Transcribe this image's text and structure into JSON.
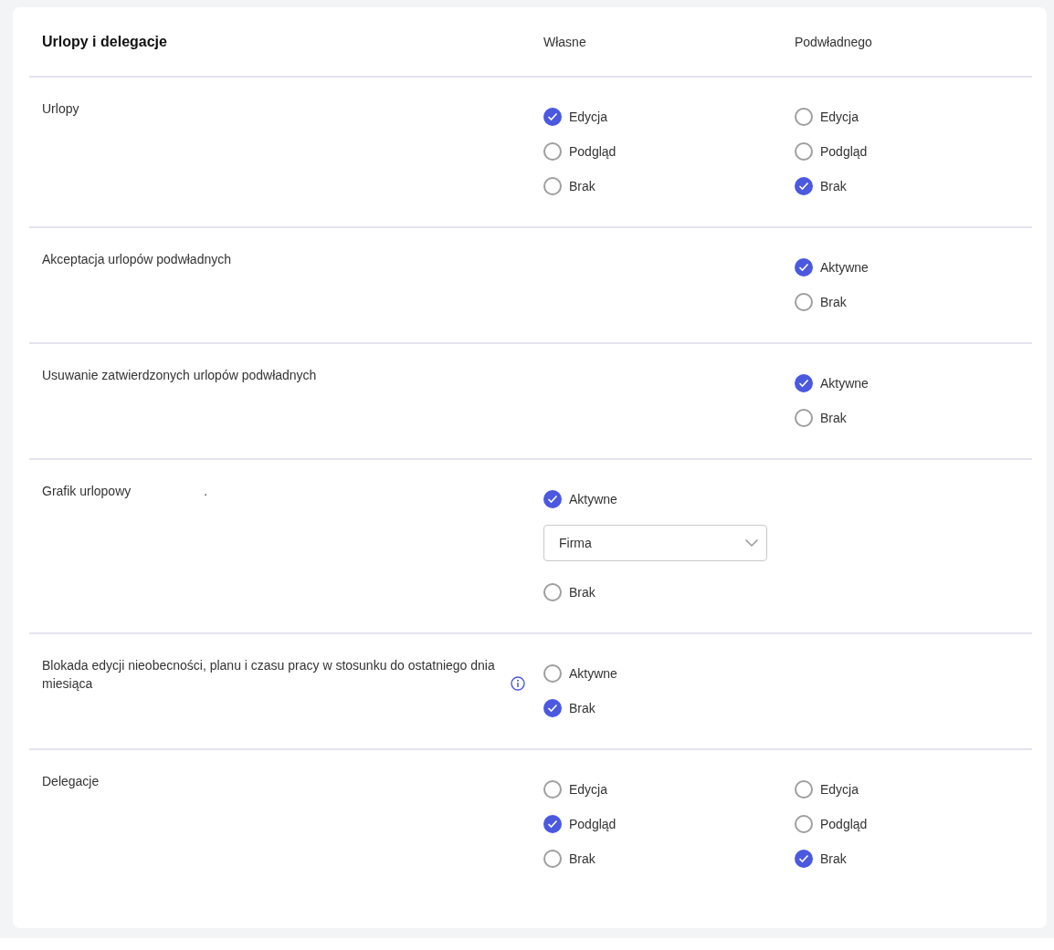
{
  "header": {
    "title": "Urlopy i delegacje",
    "columns": [
      "Własne",
      "Podwładnego"
    ]
  },
  "rows": [
    {
      "label": "Urlopy",
      "info": false,
      "own": [
        {
          "kind": "radio",
          "label": "Edycja",
          "selected": true
        },
        {
          "kind": "radio",
          "label": "Podgląd",
          "selected": false
        },
        {
          "kind": "radio",
          "label": "Brak",
          "selected": false
        }
      ],
      "sub": [
        {
          "kind": "radio",
          "label": "Edycja",
          "selected": false
        },
        {
          "kind": "radio",
          "label": "Podgląd",
          "selected": false
        },
        {
          "kind": "radio",
          "label": "Brak",
          "selected": true
        }
      ]
    },
    {
      "label": "Akceptacja urlopów podwładnych",
      "info": false,
      "own": [],
      "sub": [
        {
          "kind": "radio",
          "label": "Aktywne",
          "selected": true
        },
        {
          "kind": "radio",
          "label": "Brak",
          "selected": false
        }
      ]
    },
    {
      "label": "Usuwanie zatwierdzonych urlopów podwładnych",
      "info": false,
      "own": [],
      "sub": [
        {
          "kind": "radio",
          "label": "Aktywne",
          "selected": true
        },
        {
          "kind": "radio",
          "label": "Brak",
          "selected": false
        }
      ]
    },
    {
      "label": "Grafik urlopowy",
      "note": ".",
      "info": false,
      "own": [
        {
          "kind": "radio",
          "label": "Aktywne",
          "selected": true
        },
        {
          "kind": "select",
          "value": "Firma"
        },
        {
          "kind": "radio",
          "label": "Brak",
          "selected": false
        }
      ],
      "sub": []
    },
    {
      "label": "Blokada edycji nieobecności, planu i czasu pracy w stosunku do ostatniego dnia miesiąca",
      "info": true,
      "own": [
        {
          "kind": "radio",
          "label": "Aktywne",
          "selected": false
        },
        {
          "kind": "radio",
          "label": "Brak",
          "selected": true
        }
      ],
      "sub": []
    },
    {
      "label": "Delegacje",
      "info": false,
      "own": [
        {
          "kind": "radio",
          "label": "Edycja",
          "selected": false
        },
        {
          "kind": "radio",
          "label": "Podgląd",
          "selected": true
        },
        {
          "kind": "radio",
          "label": "Brak",
          "selected": false
        }
      ],
      "sub": [
        {
          "kind": "radio",
          "label": "Edycja",
          "selected": false
        },
        {
          "kind": "radio",
          "label": "Podgląd",
          "selected": false
        },
        {
          "kind": "radio",
          "label": "Brak",
          "selected": true
        }
      ]
    }
  ]
}
